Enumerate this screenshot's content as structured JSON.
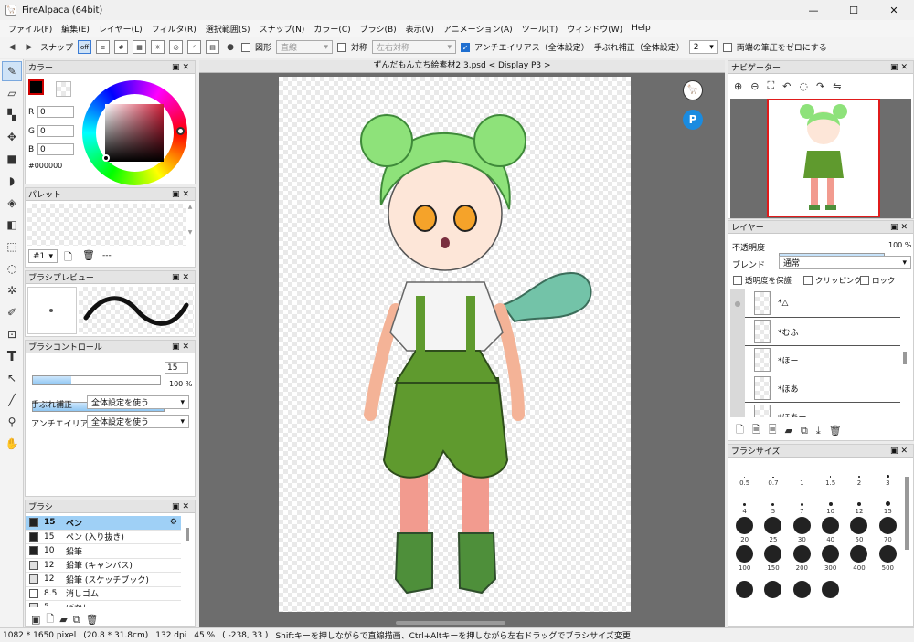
{
  "window": {
    "title": "FireAlpaca (64bit)",
    "minimize": "—",
    "maximize": "☐",
    "close": "✕"
  },
  "menu": [
    "ファイル(F)",
    "編集(E)",
    "レイヤー(L)",
    "フィルタ(R)",
    "選択範囲(S)",
    "スナップ(N)",
    "カラー(C)",
    "ブラシ(B)",
    "表示(V)",
    "アニメーション(A)",
    "ツール(T)",
    "ウィンドウ(W)",
    "Help"
  ],
  "toolbar": {
    "snap_label": "スナップ",
    "snap_off": "off",
    "shape_label": "図形",
    "shape_value": "直線",
    "symmetry_label": "対称",
    "symmetry_value": "左右対称",
    "antialias_label": "アンチエイリアス（全体設定）",
    "stabilizer_label": "手ぶれ補正（全体設定）",
    "stabilizer_value": "2",
    "taper_label": "両端の筆圧をゼロにする"
  },
  "color_panel": {
    "title": "カラー",
    "r_label": "R",
    "r": "0",
    "g_label": "G",
    "g": "0",
    "b_label": "B",
    "b": "0",
    "hex": "#000000",
    "foreground": "#000000",
    "hue_color": "#d01f3a"
  },
  "palette_panel": {
    "title": "パレット",
    "selector": "#1",
    "name": "---"
  },
  "brush_preview_panel": {
    "title": "ブラシプレビュー"
  },
  "brush_control_panel": {
    "title": "ブラシコントロール",
    "size": "15",
    "opacity": "100 %",
    "opacity_value": 1.0,
    "stabilizer_label": "手ぶれ補正",
    "stabilizer_value": "全体設定を使う",
    "antialias_label": "アンチエイリアス",
    "antialias_value": "全体設定を使う"
  },
  "brush_panel": {
    "title": "ブラシ",
    "items": [
      {
        "size": "15",
        "name": "ペン",
        "swatch": "#222222"
      },
      {
        "size": "15",
        "name": "ペン (入り抜き)",
        "swatch": "#222222"
      },
      {
        "size": "10",
        "name": "鉛筆",
        "swatch": "#222222"
      },
      {
        "size": "12",
        "name": "鉛筆 (キャンバス)",
        "swatch": "#e0e0e0"
      },
      {
        "size": "12",
        "name": "鉛筆 (スケッチブック)",
        "swatch": "#e0e0e0"
      },
      {
        "size": "8.5",
        "name": "消しゴム",
        "swatch": "#ffffff"
      },
      {
        "size": "5",
        "name": "ぼかし",
        "swatch": "#e0e0e0"
      }
    ]
  },
  "canvas": {
    "tab_title": "ずんだもん立ち絵素材2.3.psd < Display P3 >"
  },
  "navigator_panel": {
    "title": "ナビゲーター"
  },
  "layer_panel": {
    "title": "レイヤー",
    "opacity_label": "不透明度",
    "opacity": "100 %",
    "opacity_value": 1.0,
    "blend_label": "ブレンド",
    "blend_value": "通常",
    "protect_alpha": "透明度を保護",
    "clipping": "クリッピング",
    "lock": "ロック",
    "layers": [
      "*△",
      "*むふ",
      "*ほー",
      "*ほあ",
      "*ほあー"
    ]
  },
  "brush_size_panel": {
    "title": "ブラシサイズ",
    "sizes": [
      "0.5",
      "0.7",
      "1",
      "1.5",
      "2",
      "3",
      "4",
      "5",
      "7",
      "10",
      "12",
      "15",
      "20",
      "25",
      "30",
      "40",
      "50",
      "70",
      "100",
      "150",
      "200",
      "300",
      "400",
      "500",
      "",
      "",
      "",
      ""
    ]
  },
  "status": {
    "image_size": "1082 * 1650 pixel",
    "physical_size": "(20.8 * 31.8cm)",
    "dpi": "132 dpi",
    "zoom": "45 %",
    "cursor": "( -238, 33 )",
    "hint": "Shiftキーを押しながらで直線描画、Ctrl+Altキーを押しながら左右ドラッグでブラシサイズ変更"
  }
}
